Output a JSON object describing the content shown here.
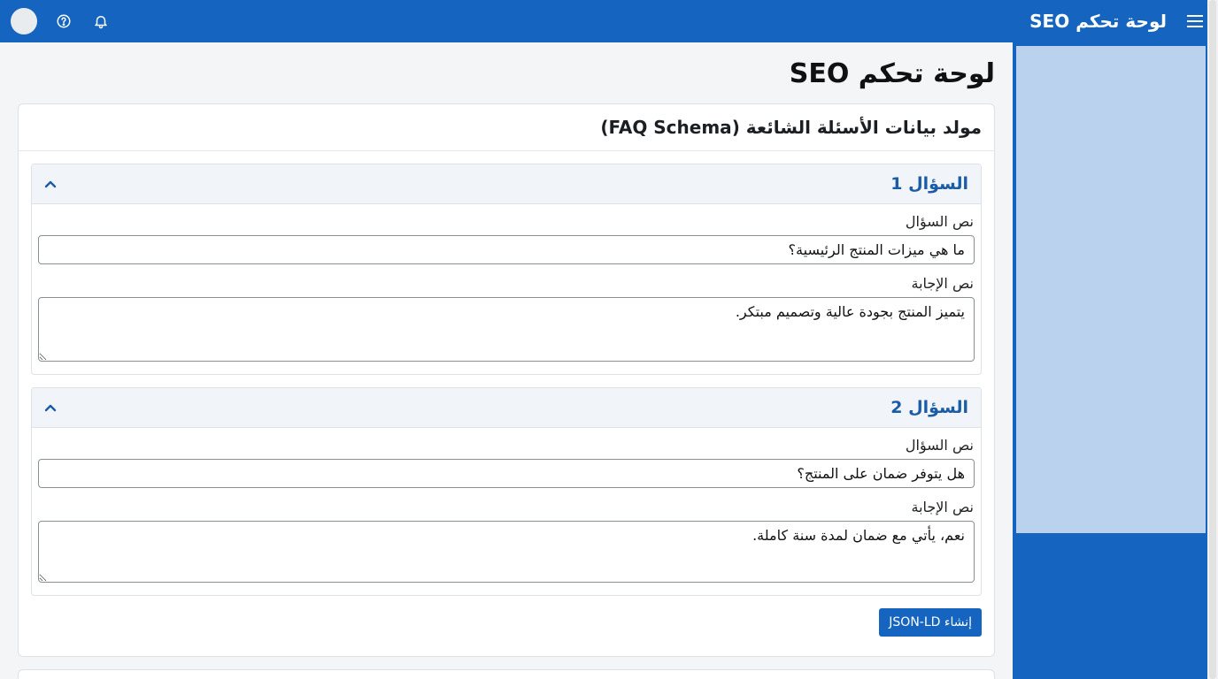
{
  "header": {
    "brand": "لوحة تحكم SEO",
    "icons": [
      "menu-icon",
      "help-icon",
      "bell-icon"
    ]
  },
  "page": {
    "title": "لوحة تحكم SEO"
  },
  "faq_card": {
    "title": "مولد بيانات الأسئلة الشائعة (FAQ Schema)",
    "items": [
      {
        "title": "السؤال 1",
        "question_label": "نص السؤال",
        "question_value": "ما هي ميزات المنتج الرئيسية؟",
        "answer_label": "نص الإجابة",
        "answer_value": "يتميز المنتج بجودة عالية وتصميم مبتكر."
      },
      {
        "title": "السؤال 2",
        "question_label": "نص السؤال",
        "question_value": "هل يتوفر ضمان على المنتج؟",
        "answer_label": "نص الإجابة",
        "answer_value": "نعم، يأتي مع ضمان لمدة سنة كاملة."
      }
    ],
    "generate_label": "إنشاء JSON-LD"
  },
  "colors": {
    "primary": "#1565c0",
    "panel": "#bbd2ef",
    "accordion_title": "#1a5ca6"
  }
}
